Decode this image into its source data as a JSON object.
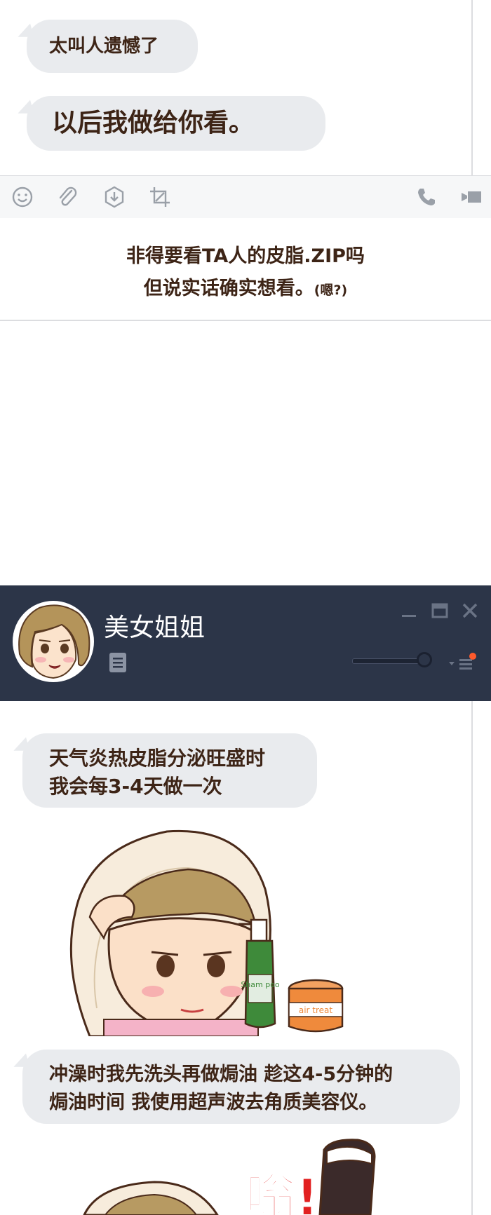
{
  "chat_top": {
    "messages": [
      "太叫人遗憾了",
      "以后我做给你看。"
    ]
  },
  "toolbar": {
    "icons": [
      "smiley-icon",
      "paperclip-icon",
      "download-icon",
      "crop-icon",
      "phone-icon",
      "video-icon"
    ]
  },
  "caption": {
    "line1": "非得要看TA人的皮脂.ZIP吗",
    "line2": "但说实话确实想看。",
    "line2_note": "(嗯?)"
  },
  "chat_window": {
    "contact_name": "美女姐姐",
    "controls": [
      "minimize",
      "maximize",
      "close"
    ]
  },
  "chat_bottom": {
    "message1_line1": "天气炎热皮脂分泌旺盛时",
    "message1_line2": "我会每3-4天做一次",
    "message2_line1": "冲澡时我先洗头再做焗油 趁这4-5分钟的",
    "message2_line2": "焗油时间 我使用超声波去角质美容仪。",
    "bottle_label": "Sham poo",
    "jar_label": "air treat",
    "sound_effect": "嗡!"
  },
  "colors": {
    "bubble": "#e9ebee",
    "text": "#3d2416",
    "titlebar": "#2c3548",
    "accent_dot": "#ff5a2c"
  }
}
